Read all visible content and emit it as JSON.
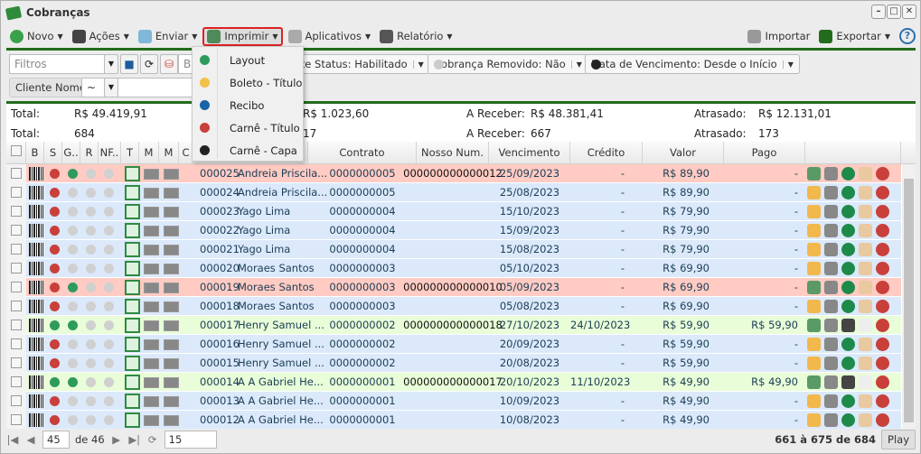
{
  "window": {
    "title": "Cobranças",
    "controls": [
      "minimize",
      "maximize",
      "close"
    ]
  },
  "toolbar": {
    "items": [
      {
        "label": "Novo",
        "icon": "plus-circle-icon",
        "color": "#3aa14b",
        "menu": true
      },
      {
        "label": "Ações",
        "icon": "gears-icon",
        "color": "#444",
        "menu": true
      },
      {
        "label": "Enviar",
        "icon": "send-icon",
        "color": "#7fb8d9",
        "menu": true
      },
      {
        "label": "Imprimir",
        "icon": "printer-icon",
        "color": "#4e8a5a",
        "menu": true,
        "active": true
      },
      {
        "label": "Aplicativos",
        "icon": "box-icon",
        "color": "#aaa",
        "menu": true
      },
      {
        "label": "Relatório",
        "icon": "report-icon",
        "color": "#555",
        "menu": true
      }
    ],
    "right": [
      {
        "label": "Importar",
        "icon": "database-import-icon",
        "color": "#999"
      },
      {
        "label": "Exportar",
        "icon": "export-icon",
        "color": "#236b1d",
        "menu": true
      }
    ],
    "help": "?"
  },
  "print_menu": {
    "items": [
      {
        "label": "Layout",
        "color": "#2e9a5c"
      },
      {
        "label": "Boleto - Título",
        "color": "#f3c14a"
      },
      {
        "label": "Recibo",
        "color": "#1864a8"
      },
      {
        "label": "Carnê - Título",
        "color": "#c9403b"
      },
      {
        "label": "Carnê - Capa",
        "color": "#222222"
      }
    ]
  },
  "filters": {
    "placeholder": "Filtros",
    "search_partial": "Bu",
    "chips": [
      {
        "label": "Cliente Status: Habilitado",
        "dot": null
      },
      {
        "label": "Cobrança Removido: Não",
        "dot": "#cccccc"
      },
      {
        "label": "Data de Vencimento: Desde o Início",
        "dot": "#222222"
      }
    ],
    "field_label": "Cliente Nome",
    "operator": "~",
    "value": ""
  },
  "totals": {
    "row1": {
      "total_label": "Total:",
      "total": "R$ 49.419,91",
      "mid": "R$ 1.023,60",
      "areceber_label": "A Receber:",
      "areceber": "R$ 48.381,41",
      "atrasado_label": "Atrasado:",
      "atrasado": "R$ 12.131,01"
    },
    "row2": {
      "total_label": "Total:",
      "total": "684",
      "mid": "17",
      "areceber_label": "A Receber:",
      "areceber": "667",
      "atrasado_label": "Atrasado:",
      "atrasado": "173"
    }
  },
  "grid": {
    "headers": [
      "B",
      "S",
      "G..",
      "R",
      "NF..",
      "T",
      "M",
      "M",
      "C",
      "",
      "Contrato",
      "Nosso Num.",
      "Vencimento",
      "Crédito",
      "Valor",
      "Pago"
    ],
    "rows": [
      {
        "id": "000025",
        "cliente": "Andreia Priscila...",
        "contrato": "0000000005",
        "nosso": "000000000000012",
        "venc": "25/09/2023",
        "credito": "-",
        "valor": "R$ 89,90",
        "pago": "-",
        "status": "overdue",
        "s": "#c9403b",
        "g": "#2e9a5c"
      },
      {
        "id": "000024",
        "cliente": "Andreia Priscila...",
        "contrato": "0000000005",
        "nosso": "",
        "venc": "25/08/2023",
        "credito": "-",
        "valor": "R$ 89,90",
        "pago": "-",
        "status": "open",
        "s": "#c9403b",
        "g": "#d0d0d0"
      },
      {
        "id": "000023",
        "cliente": "Yago Lima",
        "contrato": "0000000004",
        "nosso": "",
        "venc": "15/10/2023",
        "credito": "-",
        "valor": "R$ 79,90",
        "pago": "-",
        "status": "open",
        "s": "#c9403b",
        "g": "#d0d0d0"
      },
      {
        "id": "000022",
        "cliente": "Yago Lima",
        "contrato": "0000000004",
        "nosso": "",
        "venc": "15/09/2023",
        "credito": "-",
        "valor": "R$ 79,90",
        "pago": "-",
        "status": "open",
        "s": "#c9403b",
        "g": "#d0d0d0"
      },
      {
        "id": "000021",
        "cliente": "Yago Lima",
        "contrato": "0000000004",
        "nosso": "",
        "venc": "15/08/2023",
        "credito": "-",
        "valor": "R$ 79,90",
        "pago": "-",
        "status": "open",
        "s": "#c9403b",
        "g": "#d0d0d0"
      },
      {
        "id": "000020",
        "cliente": "Moraes Santos",
        "contrato": "0000000003",
        "nosso": "",
        "venc": "05/10/2023",
        "credito": "-",
        "valor": "R$ 69,90",
        "pago": "-",
        "status": "open",
        "s": "#c9403b",
        "g": "#d0d0d0"
      },
      {
        "id": "000019",
        "cliente": "Moraes Santos",
        "contrato": "0000000003",
        "nosso": "000000000000010",
        "venc": "05/09/2023",
        "credito": "-",
        "valor": "R$ 69,90",
        "pago": "-",
        "status": "overdue",
        "s": "#c9403b",
        "g": "#2e9a5c"
      },
      {
        "id": "000018",
        "cliente": "Moraes Santos",
        "contrato": "0000000003",
        "nosso": "",
        "venc": "05/08/2023",
        "credito": "-",
        "valor": "R$ 69,90",
        "pago": "-",
        "status": "open",
        "s": "#c9403b",
        "g": "#d0d0d0"
      },
      {
        "id": "000017",
        "cliente": "Henry Samuel ...",
        "contrato": "0000000002",
        "nosso": "000000000000018",
        "venc": "27/10/2023",
        "credito": "24/10/2023",
        "valor": "R$ 59,90",
        "pago": "R$ 59,90",
        "status": "paid",
        "s": "#2e9a5c",
        "g": "#2e9a5c"
      },
      {
        "id": "000016",
        "cliente": "Henry Samuel ...",
        "contrato": "0000000002",
        "nosso": "",
        "venc": "20/09/2023",
        "credito": "-",
        "valor": "R$ 59,90",
        "pago": "-",
        "status": "open",
        "s": "#c9403b",
        "g": "#d0d0d0"
      },
      {
        "id": "000015",
        "cliente": "Henry Samuel ...",
        "contrato": "0000000002",
        "nosso": "",
        "venc": "20/08/2023",
        "credito": "-",
        "valor": "R$ 59,90",
        "pago": "-",
        "status": "open",
        "s": "#c9403b",
        "g": "#d0d0d0"
      },
      {
        "id": "000014",
        "cliente": "A A Gabriel He...",
        "contrato": "0000000001",
        "nosso": "000000000000017",
        "venc": "20/10/2023",
        "credito": "11/10/2023",
        "valor": "R$ 49,90",
        "pago": "R$ 49,90",
        "status": "paid",
        "s": "#2e9a5c",
        "g": "#2e9a5c"
      },
      {
        "id": "000013",
        "cliente": "A A Gabriel He...",
        "contrato": "0000000001",
        "nosso": "",
        "venc": "10/09/2023",
        "credito": "-",
        "valor": "R$ 49,90",
        "pago": "-",
        "status": "open",
        "s": "#c9403b",
        "g": "#d0d0d0"
      },
      {
        "id": "000012",
        "cliente": "A A Gabriel He...",
        "contrato": "0000000001",
        "nosso": "",
        "venc": "10/08/2023",
        "credito": "-",
        "valor": "R$ 49,90",
        "pago": "-",
        "status": "open",
        "s": "#c9403b",
        "g": "#d0d0d0"
      }
    ],
    "row_colors": {
      "overdue": "#ffcbc3",
      "open": "#dbe9fb",
      "paid": "#e8fdd8"
    }
  },
  "pager": {
    "page": "45",
    "of": "de 46",
    "page_size": "15",
    "summary": "661 à 675 de 684",
    "play": "Play"
  }
}
